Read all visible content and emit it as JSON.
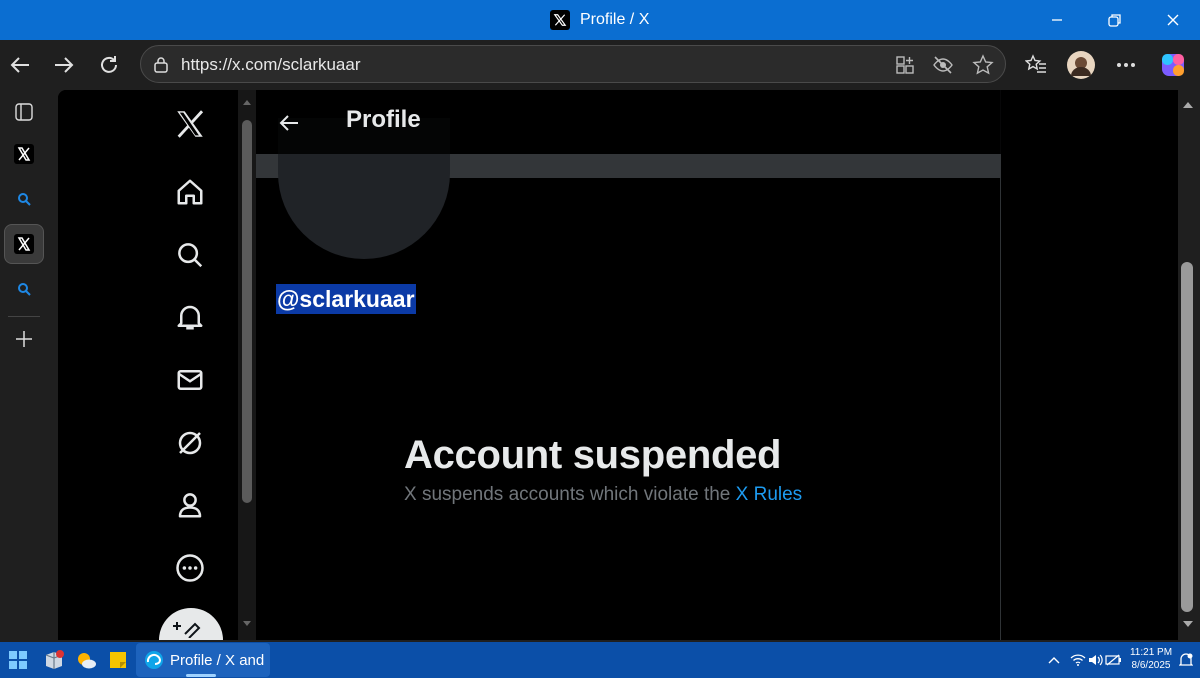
{
  "window": {
    "title": "Profile / X"
  },
  "browser": {
    "url": "https://x.com/sclarkuaar"
  },
  "page": {
    "header_title": "Profile",
    "handle": "@sclarkuaar",
    "suspended_heading": "Account suspended",
    "suspended_text": "X suspends accounts which violate the",
    "rules_link": "X Rules"
  },
  "taskbar": {
    "edge_item_label": "Profile / X and",
    "time": "11:21 PM",
    "date": "8/6/2025"
  },
  "colors": {
    "title_bar": "#0b6ed1",
    "link": "#1d9bf0",
    "selection": "#0b3aa6"
  }
}
